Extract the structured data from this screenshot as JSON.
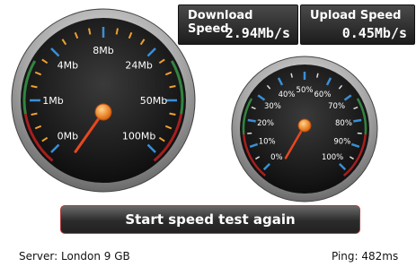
{
  "download": {
    "label": "Download Speed",
    "value": "2.94Mb/s"
  },
  "upload": {
    "label": "Upload Speed",
    "value": "0.45Mb/s"
  },
  "left_gauge": {
    "labels": [
      "0Mb",
      "1Mb",
      "4Mb",
      "8Mb",
      "24Mb",
      "50Mb",
      "100Mb"
    ]
  },
  "right_gauge": {
    "labels": [
      "0%",
      "10%",
      "20%",
      "30%",
      "40%",
      "50%",
      "60%",
      "70%",
      "80%",
      "90%",
      "100%"
    ]
  },
  "start_button": {
    "label": "Start speed test again"
  },
  "footer": {
    "server": "Server: London 9 GB",
    "ping": "Ping: 482ms"
  },
  "colors": {
    "needle": "#e8471e",
    "hub": "#f08a1e",
    "tick_blue": "#3a8fd6",
    "tick_orange": "#f0a030",
    "tick_white": "#dddddd",
    "button_border": "#b03a3a"
  }
}
